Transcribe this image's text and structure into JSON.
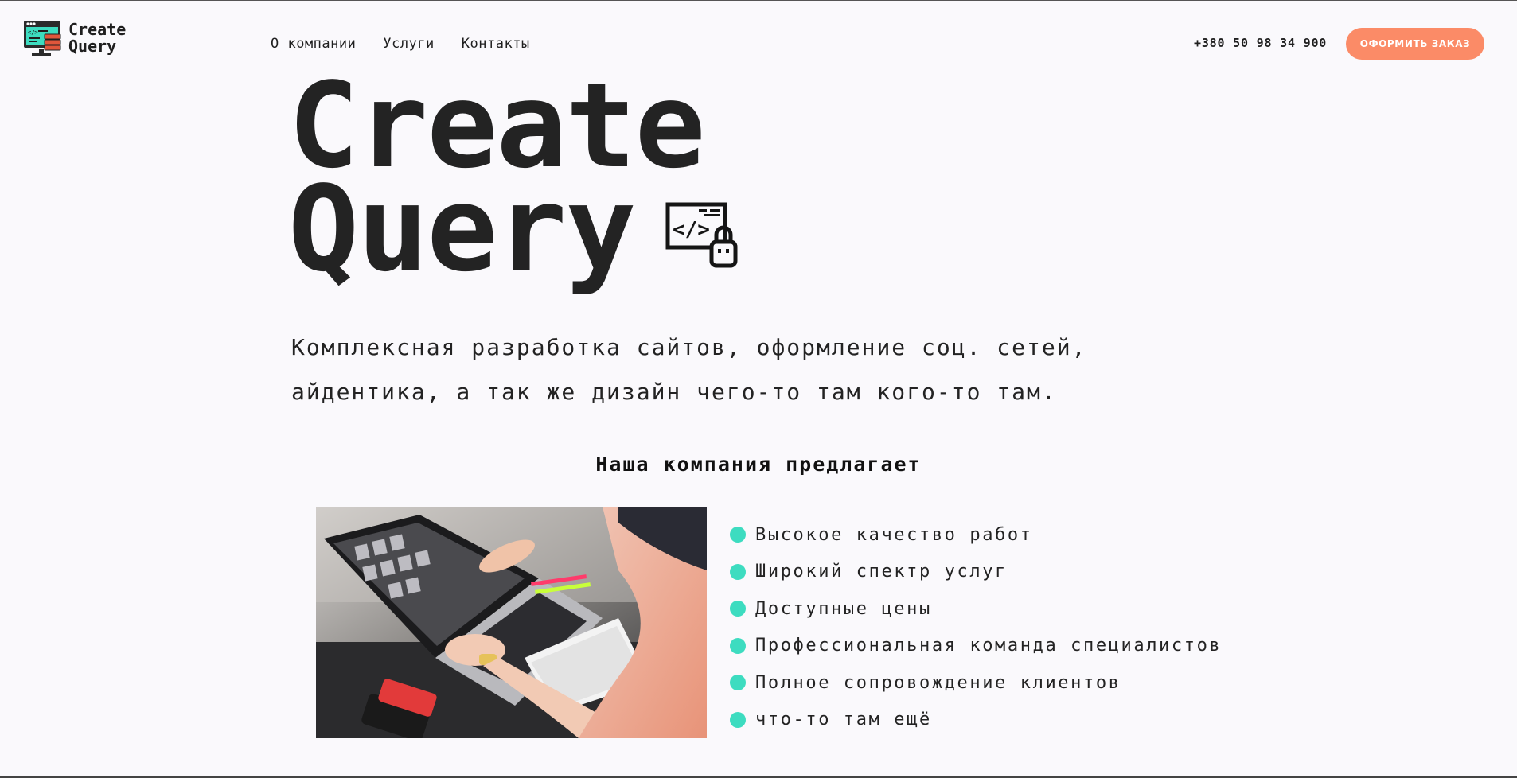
{
  "brand": {
    "name_line1": "Create",
    "name_line2": "Query",
    "logo_icon": "monitor-code-server-icon",
    "accent_teal": "#3ddcc0",
    "accent_orange": "#fb8b67"
  },
  "nav": {
    "items": [
      {
        "label": "О компании"
      },
      {
        "label": "Услуги"
      },
      {
        "label": "Контакты"
      }
    ]
  },
  "header": {
    "phone": "+380 50 98 34 900",
    "order_button": "ОФОРМИТЬ ЗАКАЗ"
  },
  "hero": {
    "title_line1": "Create",
    "title_line2": "Query",
    "icon": "code-window-lock-icon",
    "subtitle_line1": "Комплексная разработка сайтов, оформление соц. сетей,",
    "subtitle_line2": "айдентика, а так же дизайн чего-то там кого-то там."
  },
  "offers": {
    "title": "Наша компания предлагает",
    "image": "laptop-team-photo",
    "items": [
      "Высокое качество работ",
      "Широкий спектр услуг",
      "Доступные цены",
      "Профессиональная команда специалистов",
      "Полное сопровождение клиентов",
      "что-то там ещё"
    ]
  }
}
